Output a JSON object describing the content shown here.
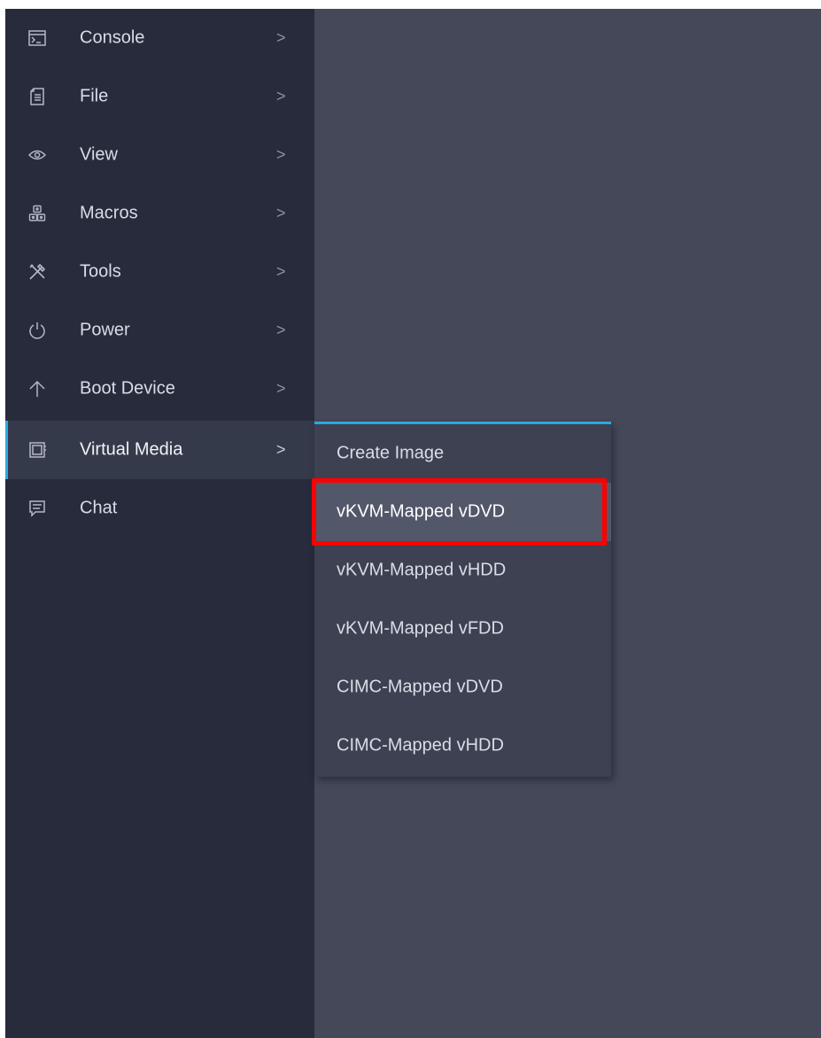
{
  "menu": {
    "items": [
      {
        "label": "Console",
        "icon": "console-icon",
        "chevron": ">"
      },
      {
        "label": "File",
        "icon": "file-icon",
        "chevron": ">"
      },
      {
        "label": "View",
        "icon": "eye-icon",
        "chevron": ">"
      },
      {
        "label": "Macros",
        "icon": "macros-icon",
        "chevron": ">"
      },
      {
        "label": "Tools",
        "icon": "tools-icon",
        "chevron": ">"
      },
      {
        "label": "Power",
        "icon": "power-icon",
        "chevron": ">"
      },
      {
        "label": "Boot Device",
        "icon": "arrow-up-icon",
        "chevron": ">"
      },
      {
        "label": "Virtual Media",
        "icon": "virtual-media-icon",
        "chevron": ">",
        "active": true
      },
      {
        "label": "Chat",
        "icon": "chat-icon"
      }
    ]
  },
  "submenu": {
    "items": [
      {
        "label": "Create Image"
      },
      {
        "label": "vKVM-Mapped vDVD",
        "highlighted": true
      },
      {
        "label": "vKVM-Mapped vHDD"
      },
      {
        "label": "vKVM-Mapped vFDD"
      },
      {
        "label": "CIMC-Mapped vDVD"
      },
      {
        "label": "CIMC-Mapped vHDD"
      }
    ]
  },
  "colors": {
    "sidebar_bg": "#272b3b",
    "content_bg": "#444859",
    "accent": "#2da8e2",
    "highlight_outline": "#ff0000"
  }
}
